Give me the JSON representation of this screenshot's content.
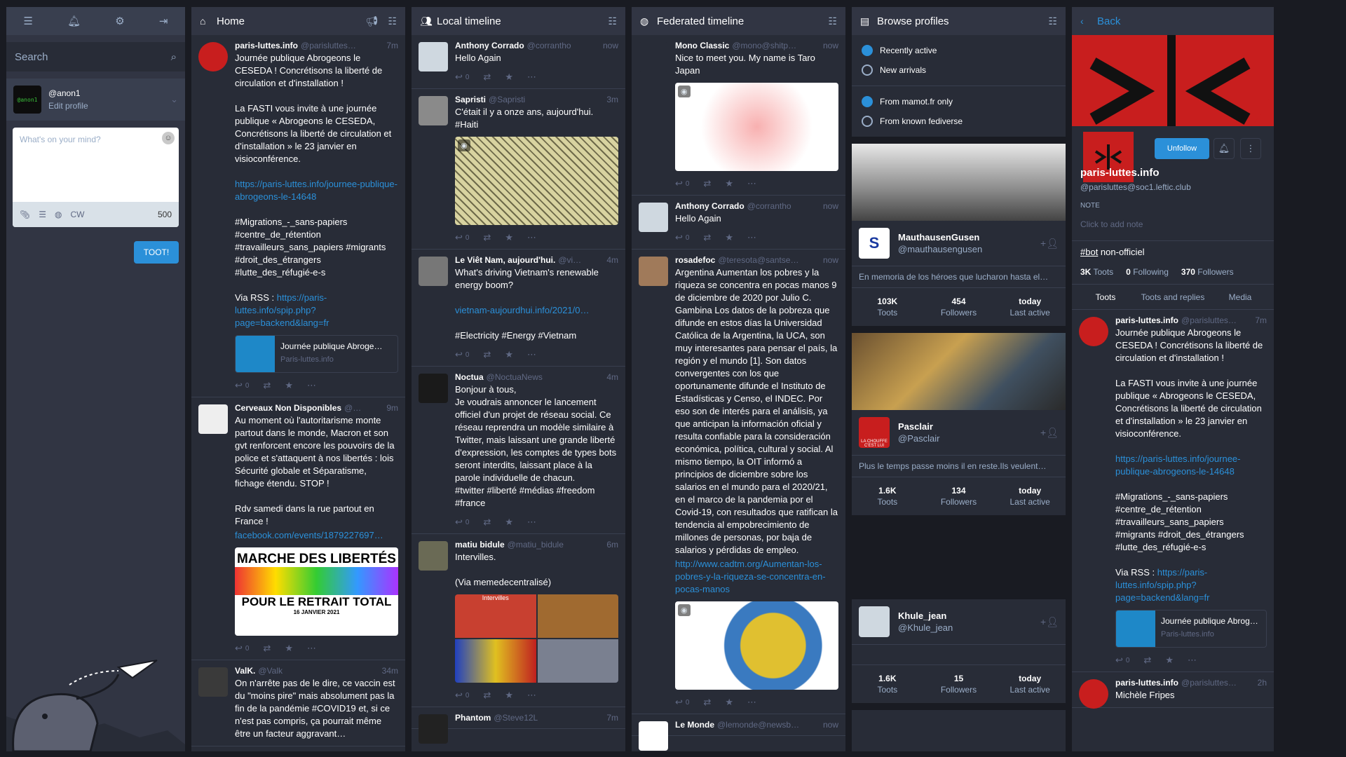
{
  "drawer": {
    "search_placeholder": "Search",
    "account_handle": "@anon1",
    "account_edit": "Edit profile",
    "avatar_text": "@anon1",
    "compose_placeholder": "What's on your mind?",
    "cw_label": "CW",
    "char_count": "500",
    "toot_button": "TOOT!"
  },
  "home": {
    "title": "Home",
    "statuses": [
      {
        "name": "paris-luttes.info",
        "acct": "@parisluttes…",
        "time": "7m",
        "text": "Journée publique Abrogeons le CESEDA ! Concrétisons la liberté de circulation et d'installation !\n\nLa FASTI vous invite à une journée publique « Abrogeons le CESEDA, Concrétisons la liberté de circulation et d'installation » le 23 janvier en visioconférence.",
        "link": "https://paris-luttes.info/journee-publique-abrogeons-le-14648",
        "tags": "#Migrations_-_sans-papiers\n#centre_de_rétention\n#travailleurs_sans_papiers #migrants\n#droit_des_étrangers\n#lutte_des_réfugié-e-s",
        "rss_label": "Via RSS : ",
        "rss_link": "https://paris-luttes.info/spip.php?page=backend&lang=fr",
        "card_title": "Journée publique Abroge…",
        "card_site": "Paris-luttes.info",
        "replies": "0"
      },
      {
        "name": "Cerveaux Non Disponibles",
        "acct": "@…",
        "time": "9m",
        "text": "Au moment où l'autoritarisme monte partout dans le monde, Macron et son gvt renforcent encore les pouvoirs de la police et s'attaquent à nos libertés : lois Sécurité globale et Séparatisme, fichage étendu. STOP !\n\nRdv samedi dans la rue partout en France !",
        "link": "facebook.com/events/1879227697…",
        "poster_line1": "MARCHE DES LIBERTÉS",
        "poster_line2": "POUR LE RETRAIT TOTAL",
        "poster_date": "16 JANVIER 2021",
        "replies": "0"
      },
      {
        "name": "ValK.",
        "acct": "@Valk",
        "time": "34m",
        "text": "On n'arrête pas de le dire, ce vaccin est du \"moins pire\" mais absolument pas la fin de la pandémie #COVID19 et, si ce n'est pas compris, ça pourrait même être un facteur aggravant…"
      }
    ]
  },
  "local": {
    "title": "Local timeline",
    "statuses": [
      {
        "name": "Anthony Corrado",
        "acct": "@corrantho",
        "time": "now",
        "text": "Hello Again",
        "replies": "0"
      },
      {
        "name": "Sapristi",
        "acct": "@Sapristi",
        "time": "3m",
        "text": "C'était il y a onze ans, aujourd'hui.\n#Haiti",
        "replies": "0"
      },
      {
        "name": "Le Viêt Nam, aujourd'hui.",
        "acct": "@vi…",
        "time": "4m",
        "text": "What's driving Vietnam's renewable energy boom?",
        "link": "vietnam-aujourdhui.info/2021/0…",
        "tags": "#Electricity #Energy #Vietnam",
        "replies": "0"
      },
      {
        "name": "Noctua",
        "acct": "@NoctuaNews",
        "time": "4m",
        "text": "Bonjour à tous,\nJe voudrais annoncer le lancement officiel d'un projet de réseau social. Ce réseau reprendra un modèle similaire à Twitter, mais laissant une grande liberté d'expression, les comptes de types bots seront interdits, laissant place à la parole individuelle de chacun.\n#twitter #liberté #médias #freedom #france",
        "replies": "0"
      },
      {
        "name": "matiu bidule",
        "acct": "@matiu_bidule",
        "time": "6m",
        "text": "Intervilles.\n\n(Via memedecentralisé)",
        "media_caption": "Intervilles",
        "replies": "0"
      },
      {
        "name": "Phantom",
        "acct": "@Steve12L",
        "time": "7m",
        "text": ""
      }
    ]
  },
  "federated": {
    "title": "Federated timeline",
    "statuses": [
      {
        "name": "Mono Classic",
        "acct": "@mono@shitp…",
        "time": "now",
        "text": "Nice to meet you. My name is Taro Japan",
        "replies": "0"
      },
      {
        "name": "Anthony Corrado",
        "acct": "@corrantho",
        "time": "now",
        "text": "Hello Again",
        "replies": "0"
      },
      {
        "name": "rosadefoc",
        "acct": "@teresota@santse…",
        "time": "now",
        "text": "Argentina Aumentan los pobres y la riqueza se concentra en pocas manos 9 de diciembre de 2020 por Julio C. Gambina Los datos de la pobreza que difunde en estos días la Universidad Católica de la Argentina, la UCA, son muy interesantes para pensar el país, la región y el mundo [1]. Son datos convergentes con los que oportunamente difunde el Instituto de Estadísticas y Censo, el INDEC. Por eso son de interés para el análisis, ya que anticipan la información oficial y resulta confiable para la consideración económica, política, cultural y social. Al mismo tiempo, la OIT informó a principios de diciembre sobre los salarios en el mundo para el 2020/21, en el marco de la pandemia por el Covid-19, con resultados que ratifican la tendencia al empobrecimiento de millones de personas, por baja de salarios y pérdidas de empleo.",
        "link": "http://www.cadtm.org/Aumentan-los-pobres-y-la-riqueza-se-concentra-en-pocas-manos",
        "replies": "0"
      },
      {
        "name": "Le Monde",
        "acct": "@lemonde@newsb…",
        "time": "now",
        "text": ""
      }
    ]
  },
  "browse": {
    "title": "Browse profiles",
    "order_options": [
      "Recently active",
      "New arrivals"
    ],
    "scope_options": [
      "From mamot.fr only",
      "From known fediverse"
    ],
    "profiles": [
      {
        "name": "MauthausenGusen",
        "handle": "@mauthausengusen",
        "bio": "En memoria de los héroes que lucharon hasta el…",
        "toots": "103K",
        "followers": "454",
        "last": "today",
        "avatar_letter": "S"
      },
      {
        "name": "Pasclair",
        "handle": "@Pasclair",
        "bio": "Plus le temps passe moins il en reste.Ils veulent…",
        "toots": "1.6K",
        "followers": "134",
        "last": "today",
        "avatar_caption": "LA CHOUFFE C'EST LUI"
      },
      {
        "name": "Khule_jean",
        "handle": "@Khule_jean",
        "bio": "",
        "toots": "1.6K",
        "followers": "15",
        "last": "today"
      }
    ],
    "toots_label": "Toots",
    "followers_label": "Followers",
    "last_label": "Last active"
  },
  "account": {
    "back": "Back",
    "unfollow": "Unfollow",
    "name": "paris-luttes.info",
    "handle": "@parisluttes@soc1.leftic.club",
    "note_label": "NOTE",
    "note_placeholder": "Click to add note",
    "bio_tag": "#bot",
    "bio_text": " non-officiel",
    "toots": "3K",
    "toots_label": "Toots",
    "following": "0",
    "following_label": "Following",
    "followers": "370",
    "followers_label": "Followers",
    "tabs": [
      "Toots",
      "Toots and replies",
      "Media"
    ],
    "status1": {
      "name": "paris-luttes.info",
      "acct": "@parisluttes…",
      "time": "7m",
      "text": "Journée publique Abrogeons le CESEDA ! Concrétisons la liberté de circulation et d'installation !\n\nLa FASTI vous invite à une journée publique « Abrogeons le CESEDA, Concrétisons la liberté de circulation et d'installation » le 23 janvier en visioconférence.",
      "link": "https://paris-luttes.info/journee-publique-abrogeons-le-14648",
      "tags": "#Migrations_-_sans-papiers\n#centre_de_rétention\n#travailleurs_sans_papiers\n#migrants #droit_des_étrangers\n#lutte_des_réfugié-e-s",
      "rss_label": "Via RSS : ",
      "rss_link": "https://paris-luttes.info/spip.php?page=backend&lang=fr",
      "card_title": "Journée publique Abrog…",
      "card_site": "Paris-luttes.info",
      "replies": "0"
    },
    "status2": {
      "name": "paris-luttes.info",
      "acct": "@parisluttes…",
      "time": "2h",
      "text": "Michèle Fripes"
    }
  }
}
